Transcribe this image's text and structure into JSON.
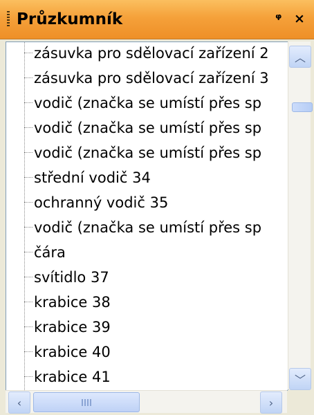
{
  "panel": {
    "title": "Průzkumník",
    "pin_icon": "pin-icon",
    "close_icon": "close-icon"
  },
  "tree": {
    "items": [
      "zásuvka pro sdělovací zařízení 2",
      "zásuvka pro sdělovací zařízení 3",
      "vodič (značka se umístí přes sp",
      "vodič (značka se umístí přes sp",
      "vodič (značka se umístí přes sp",
      "střední vodič 34",
      "ochranný vodič 35",
      "vodič (značka se umístí přes sp",
      "čára",
      "svítidlo 37",
      "krabice 38",
      "krabice 39",
      "krabice 40",
      "krabice 41"
    ]
  },
  "scrollbars": {
    "vertical_position": 0.08,
    "horizontal_position": 0.0
  }
}
